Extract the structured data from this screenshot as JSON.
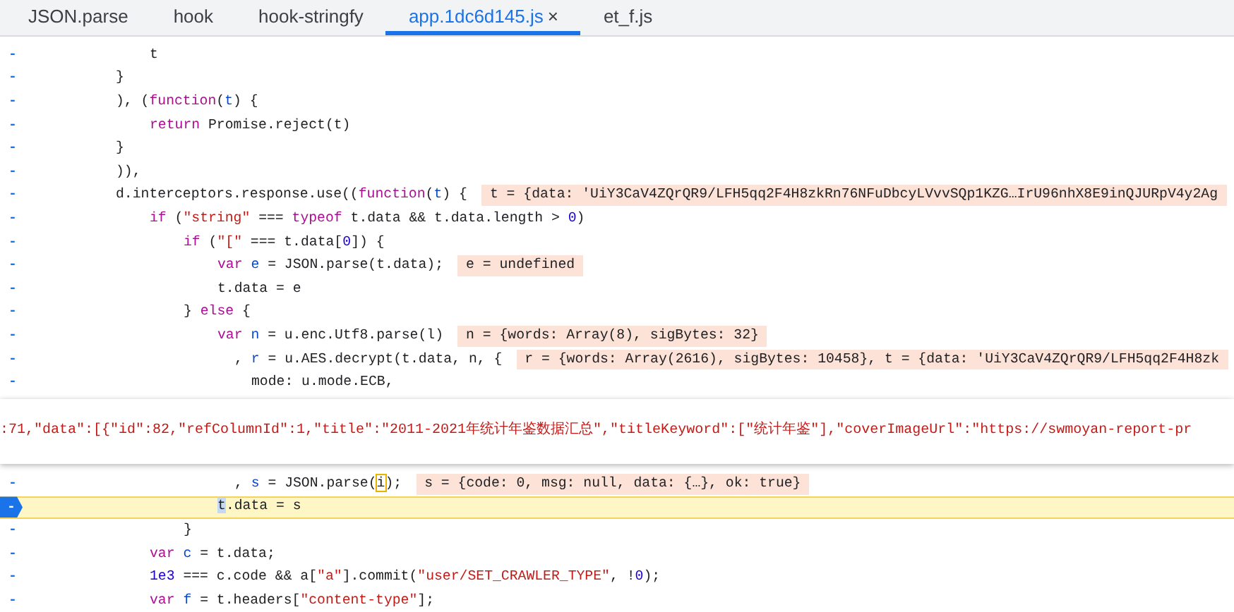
{
  "tabs": [
    {
      "label": "JSON.parse",
      "selected": false
    },
    {
      "label": "hook",
      "selected": false
    },
    {
      "label": "hook-stringfy",
      "selected": false
    },
    {
      "label": "app.1dc6d145.js",
      "selected": true,
      "close": "×"
    },
    {
      "label": "et_f.js",
      "selected": false
    }
  ],
  "code_lines": [
    {
      "children": [
        {
          "marker": "-",
          "paused": false,
          "segments": [
            {
              "t": "t",
              "kind": "plain"
            }
          ]
        }
      ]
    },
    {
      "marker": "-",
      "paused": false,
      "segments": [
        {
          "t": "}",
          "kind": "plain"
        }
      ]
    },
    {
      "marker": "-",
      "paused": false,
      "segments": [
        {
          "t": "), (",
          "kind": "plain"
        },
        {
          "t": "function",
          "kind": "kw"
        },
        {
          "t": "(",
          "kind": "plain"
        },
        {
          "t": "t",
          "kind": "def"
        },
        {
          "t": ") {",
          "kind": "plain"
        }
      ],
      "children": [
        {
          "marker": "-",
          "paused": false,
          "segments": [
            {
              "t": "return",
              "kind": "kw"
            },
            {
              "t": " Promise.reject(t)",
              "kind": "plain"
            }
          ]
        }
      ]
    },
    {
      "marker": "-",
      "paused": false,
      "segments": [
        {
          "t": "}",
          "kind": "plain"
        }
      ]
    },
    {
      "marker": "-",
      "paused": false,
      "segments": [
        {
          "t": ")),",
          "kind": "plain"
        }
      ]
    },
    {
      "marker": "-",
      "paused": false,
      "segments": [
        {
          "t": "d.interceptors.response.use((",
          "kind": "plain"
        },
        {
          "t": "function",
          "kind": "kw"
        },
        {
          "t": "(",
          "kind": "plain"
        },
        {
          "t": "t",
          "kind": "def"
        },
        {
          "t": ") {",
          "kind": "plain"
        }
      ],
      "value": "t = {data: 'UiY3CaV4ZQrQR9/LFH5qq2F4H8zkRn76NFuDbcyLVvvSQp1KZG…IrU96nhX8E9inQJURpV4y2Ag",
      "children": [
        {
          "marker": "-",
          "paused": false,
          "segments": [
            {
              "t": "if",
              "kind": "kw"
            },
            {
              "t": " (",
              "kind": "plain"
            },
            {
              "t": "\"string\"",
              "kind": "str"
            },
            {
              "t": " === ",
              "kind": "plain"
            },
            {
              "t": "typeof",
              "kind": "kw"
            },
            {
              "t": " t.data && t.data.length > ",
              "kind": "plain"
            },
            {
              "t": "0",
              "kind": "num"
            },
            {
              "t": ")",
              "kind": "plain"
            }
          ],
          "children": [
            {
              "marker": "-",
              "paused": false,
              "segments": [
                {
                  "t": "if",
                  "kind": "kw"
                },
                {
                  "t": " (",
                  "kind": "plain"
                },
                {
                  "t": "\"[\"",
                  "kind": "str"
                },
                {
                  "t": " === t.data[",
                  "kind": "plain"
                },
                {
                  "t": "0",
                  "kind": "num"
                },
                {
                  "t": "]) {",
                  "kind": "plain"
                }
              ],
              "children": [
                {
                  "marker": "-",
                  "paused": false,
                  "segments": [
                    {
                      "t": "var",
                      "kind": "kw"
                    },
                    {
                      "t": " e",
                      "kind": "def"
                    },
                    {
                      "t": " = JSON.parse(t.data);",
                      "kind": "plain"
                    }
                  ],
                  "value": "e = undefined"
                },
                {
                  "marker": "-",
                  "paused": false,
                  "segments": [
                    {
                      "t": "t.data = e",
                      "kind": "plain"
                    }
                  ]
                }
              ]
            },
            {
              "marker": "-",
              "paused": false,
              "segments": [
                {
                  "t": "} ",
                  "kind": "plain"
                },
                {
                  "t": "else",
                  "kind": "kw"
                },
                {
                  "t": " {",
                  "kind": "plain"
                }
              ],
              "children": [
                {
                  "marker": "-",
                  "paused": false,
                  "segments": [
                    {
                      "t": "var",
                      "kind": "kw"
                    },
                    {
                      "t": " n",
                      "kind": "def"
                    },
                    {
                      "t": " = u.enc.Utf8.parse(l)",
                      "kind": "plain"
                    }
                  ],
                  "value": "n = {words: Array(8), sigBytes: 32}"
                },
                {
                  "marker": "-",
                  "paused": false,
                  "continuation": true,
                  "segments": [
                    {
                      "t": ", ",
                      "kind": "plain"
                    },
                    {
                      "t": "r",
                      "kind": "def"
                    },
                    {
                      "t": " = u.AES.decrypt(t.data, n, {",
                      "kind": "plain"
                    }
                  ],
                  "value": "r = {words: Array(2616), sigBytes: 10458}, t = {data: 'UiY3CaV4ZQrQR9/LFH5qq2F4H8zk",
                  "children": [
                    {
                      "marker": "-",
                      "paused": false,
                      "segments": [
                        {
                          "t": "mode: u.mode.ECB,",
                          "kind": "plain"
                        }
                      ]
                    }
                  ]
                }
              ]
            }
          ]
        }
      ]
    }
  ],
  "hover_preview": {
    "text": ":71,\"data\":[{\"id\":82,\"refColumnId\":1,\"title\":\"2011-2021年统计年鉴数据汇总\",\"titleKeyword\":[\"统计年鉴\"],\"coverImageUrl\":\"https://swmoyan-report-pr"
  },
  "code_lines_below": [
    {
      "children": [
        {
          "children": [
            {
              "children": [
                {
                  "marker": "-",
                  "paused": false,
                  "continuation": true,
                  "segments": [
                    {
                      "t": ", ",
                      "kind": "plain"
                    },
                    {
                      "t": "s",
                      "kind": "def"
                    },
                    {
                      "t": " = JSON.parse(",
                      "kind": "plain"
                    },
                    {
                      "t": "i",
                      "kind": "hover"
                    },
                    {
                      "t": ");",
                      "kind": "plain"
                    }
                  ],
                  "value": "s = {code: 0, msg: null, data: {…}, ok: true}"
                },
                {
                  "marker": "-",
                  "paused": true,
                  "segments": [
                    {
                      "t": "t",
                      "kind": "cursor"
                    },
                    {
                      "t": ".data = s",
                      "kind": "plain"
                    }
                  ]
                }
              ]
            },
            {
              "marker": "-",
              "paused": false,
              "segments": [
                {
                  "t": "}",
                  "kind": "plain"
                }
              ]
            }
          ]
        },
        {
          "marker": "-",
          "paused": false,
          "segments": [
            {
              "t": "var",
              "kind": "kw"
            },
            {
              "t": " c",
              "kind": "def"
            },
            {
              "t": " = t.data;",
              "kind": "plain"
            }
          ]
        },
        {
          "marker": "-",
          "paused": false,
          "segments": [
            {
              "t": "1e3",
              "kind": "num"
            },
            {
              "t": " === c.code && a[",
              "kind": "plain"
            },
            {
              "t": "\"a\"",
              "kind": "str"
            },
            {
              "t": "].commit(",
              "kind": "plain"
            },
            {
              "t": "\"user/SET_CRAWLER_TYPE\"",
              "kind": "str"
            },
            {
              "t": ", !",
              "kind": "plain"
            },
            {
              "t": "0",
              "kind": "num"
            },
            {
              "t": ");",
              "kind": "plain"
            }
          ]
        },
        {
          "marker": "-",
          "paused": false,
          "segments": [
            {
              "t": "var",
              "kind": "kw"
            },
            {
              "t": " f",
              "kind": "def"
            },
            {
              "t": " = t.headers[",
              "kind": "plain"
            },
            {
              "t": "\"content-type\"",
              "kind": "str"
            },
            {
              "t": "];",
              "kind": "plain"
            }
          ]
        }
      ]
    }
  ]
}
